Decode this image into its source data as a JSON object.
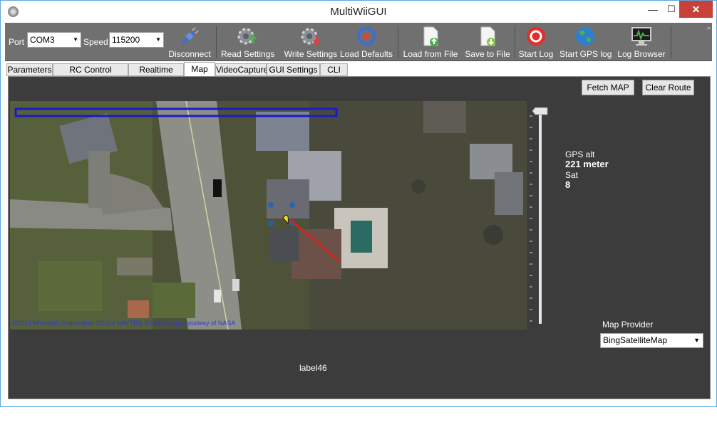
{
  "window": {
    "title": "MultiWiiGUI"
  },
  "toolbar": {
    "port_label": "Port",
    "port_value": "COM3",
    "speed_label": "Speed",
    "speed_value": "115200",
    "buttons": [
      {
        "label": "Disconnect",
        "icon": "plug-icon"
      },
      {
        "label": "Read Settings",
        "icon": "gear-up-icon"
      },
      {
        "label": "Write Settings",
        "icon": "gear-down-icon"
      },
      {
        "label": "Load Defaults",
        "icon": "reset-icon"
      },
      {
        "label": "Load from File",
        "icon": "file-load-icon"
      },
      {
        "label": "Save to File",
        "icon": "file-save-icon"
      },
      {
        "label": "Start Log",
        "icon": "record-icon"
      },
      {
        "label": "Start GPS log",
        "icon": "globe-icon"
      },
      {
        "label": "Log Browser",
        "icon": "monitor-icon"
      }
    ]
  },
  "tabs": [
    {
      "label": "Parameters"
    },
    {
      "label": "RC Control Settings"
    },
    {
      "label": "Realtime Data"
    },
    {
      "label": "Map",
      "active": true
    },
    {
      "label": "VideoCapture"
    },
    {
      "label": "GUI Settings"
    },
    {
      "label": "CLI"
    }
  ],
  "map_panel": {
    "fetch_map_label": "Fetch MAP",
    "clear_route_label": "Clear Route",
    "copyright": "©2014 Microsoft Corporation ©2014 NAVTEQ ©2014 Image courtesy of NASA",
    "gps_alt_label": "GPS alt",
    "gps_alt_value": "221 meter",
    "sat_label": "Sat",
    "sat_value": "8",
    "provider_label": "Map Provider",
    "provider_value": "BingSatelliteMap",
    "status_label": "label46"
  },
  "colors": {
    "toolbar_bg": "#707070",
    "panel_bg": "#3c3c3c",
    "close_btn": "#c7403a"
  }
}
